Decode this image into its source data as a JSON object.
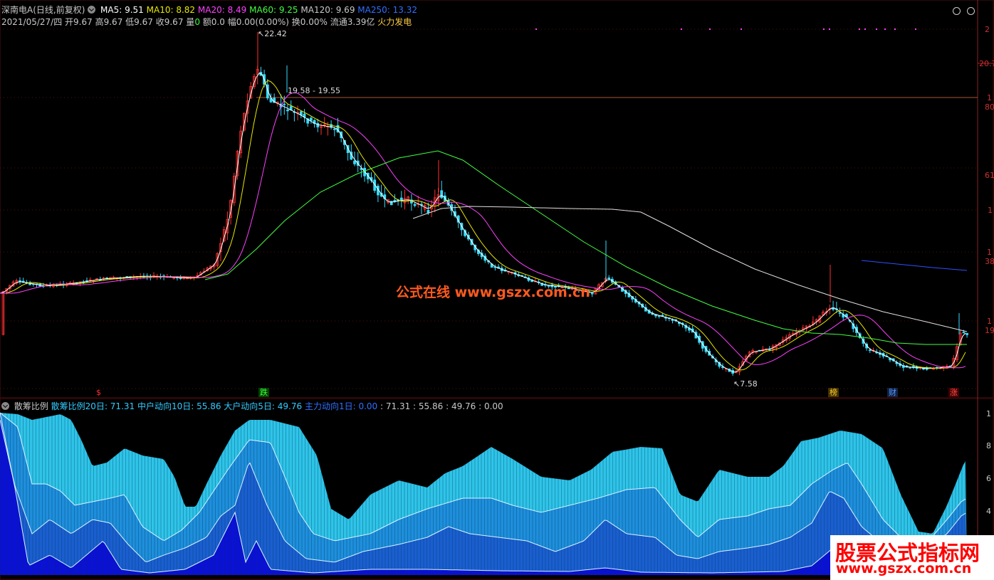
{
  "header": {
    "title": "深南电A(日线,前复权)",
    "ma5": "MA5: 9.51",
    "ma10": "MA10: 8.82",
    "ma20": "MA20: 8.49",
    "ma60": "MA60: 9.25",
    "ma120": "MA120: 9.69",
    "ma250": "MA250: 13.32",
    "info_date": "2021/05/27/四",
    "info_open": "开9.67",
    "info_high": "高9.67",
    "info_low": "低9.67",
    "info_close": "收9.67",
    "info_vol_label": "量",
    "info_vol": "0",
    "info_amt": "额0.0",
    "info_chg": "幅0.00(0.00%)",
    "info_turn": "换0.00%",
    "info_float": "流通3.39亿",
    "info_sector": "火力发电"
  },
  "chart": {
    "high_label": "22.42",
    "low_label": "7.58",
    "hline_label": "19.58 - 19.55",
    "right_axis": [
      "2",
      "20.7",
      "1",
      "80",
      "61",
      "1",
      "1",
      "38",
      "1",
      "19"
    ],
    "signals": [
      {
        "name": "signal-s",
        "text": "$",
        "color": "#ff3030",
        "bg": "transparent"
      },
      {
        "name": "signal-die",
        "text": "跌",
        "color": "#40ff40",
        "bg": "#004400"
      },
      {
        "name": "signal-bang",
        "text": "榜",
        "color": "#ffcc33",
        "bg": "#443300"
      },
      {
        "name": "signal-cai",
        "text": "财",
        "color": "#5599ff",
        "bg": "#112244"
      },
      {
        "name": "signal-zhang",
        "text": "涨",
        "color": "#ff5050",
        "bg": "#440000"
      }
    ],
    "colors": {
      "ma5": "#ffffff",
      "ma10": "#e8e800",
      "ma20": "#ff40ff",
      "ma60": "#40ff40",
      "ma120": "#e0e0e0",
      "ma250": "#3050ff",
      "up": "#ff3030",
      "down": "#33ddff"
    }
  },
  "indicator": {
    "name": "散筹比例",
    "l1": "散筹比例20日: 71.31",
    "l2": "中户动向10日: 55.86",
    "l3": "大户动向5日: 49.76",
    "l4": "主力动向1日: 0.00",
    "vals": ": 71.31 : 55.86 : 49.76 : 0.00",
    "right_axis": [
      "1",
      "8",
      "6",
      "4"
    ]
  },
  "watermarks": {
    "center": "公式在线  www.gszx.com.cn",
    "corner_title": "股票公式指标网",
    "corner_url": "www.gszx.com.cn"
  }
}
